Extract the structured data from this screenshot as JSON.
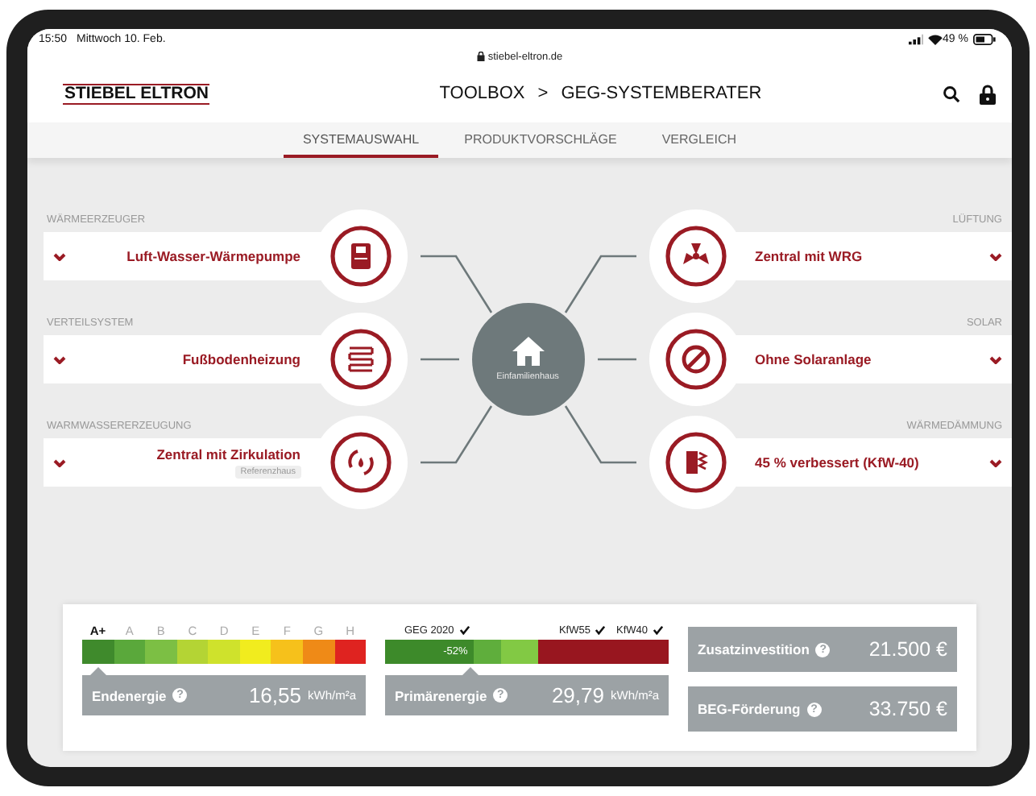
{
  "status_bar": {
    "time": "15:50",
    "date": "Mittwoch 10. Feb.",
    "battery": "49 %"
  },
  "browser": {
    "url": "stiebel-eltron.de"
  },
  "header": {
    "logo": "STIEBEL ELTRON",
    "breadcrumb": [
      "TOOLBOX",
      "GEG-SYSTEMBERATER"
    ],
    "separator": ">"
  },
  "tabs": [
    {
      "label": "SYSTEMAUSWAHL",
      "selected": true
    },
    {
      "label": "PRODUKTVORSCHLÄGE",
      "selected": false
    },
    {
      "label": "VERGLEICH",
      "selected": false
    }
  ],
  "left_options": [
    {
      "category": "WÄRMEERZEUGER",
      "value": "Luft-Wasser-Wärmepumpe"
    },
    {
      "category": "VERTEILSYSTEM",
      "value": "Fußbodenheizung"
    },
    {
      "category": "WARMWASSERERZEUGUNG",
      "value": "Zentral mit Zirkulation",
      "note": "Referenzhaus"
    }
  ],
  "hub": {
    "label": "Einfamilienhaus"
  },
  "right_options": [
    {
      "category": "LÜFTUNG",
      "value": "Zentral mit WRG"
    },
    {
      "category": "SOLAR",
      "value": "Ohne Solaranlage"
    },
    {
      "category": "WÄRMEDÄMMUNG",
      "value": "45 % verbessert (KfW-40)"
    }
  ],
  "energy_scale": {
    "classes": [
      {
        "label": "A+",
        "color": "#3f8a2c",
        "selected": true
      },
      {
        "label": "A",
        "color": "#5aa83b",
        "selected": false
      },
      {
        "label": "B",
        "color": "#7cbf44",
        "selected": false
      },
      {
        "label": "C",
        "color": "#b4d434",
        "selected": false
      },
      {
        "label": "D",
        "color": "#cfe22c",
        "selected": false
      },
      {
        "label": "E",
        "color": "#f1ec1e",
        "selected": false
      },
      {
        "label": "F",
        "color": "#f6c11b",
        "selected": false
      },
      {
        "label": "G",
        "color": "#ef8a17",
        "selected": false
      },
      {
        "label": "H",
        "color": "#df2320",
        "selected": false
      }
    ],
    "label": "Endenergie",
    "help": "?",
    "value": "16,55",
    "unit": "kWh/m²a"
  },
  "primary_energy": {
    "thresholds": [
      {
        "label": "GEG 2020",
        "checked": true
      },
      {
        "label": "KfW55",
        "checked": true
      },
      {
        "label": "KfW40",
        "checked": true
      }
    ],
    "level": 0.54,
    "reading": "-52%",
    "label": "Primärenergie",
    "help": "?",
    "value": "29,79",
    "unit": "kWh/m²a"
  },
  "costs": [
    {
      "label": "Zusatzinvestition",
      "help": "?",
      "value": "21.500 €"
    },
    {
      "label": "BEG-Förderung",
      "help": "?",
      "value": "33.750 €"
    }
  ]
}
